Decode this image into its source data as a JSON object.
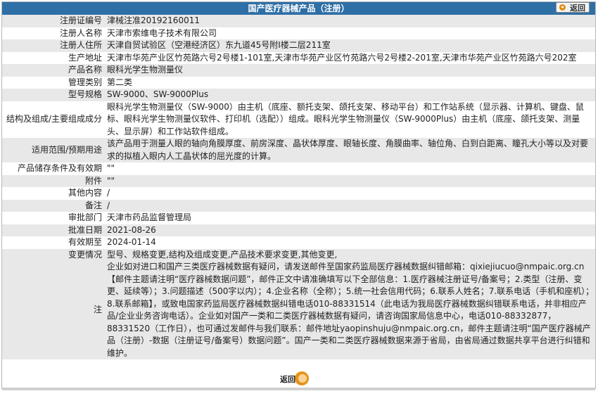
{
  "header": {
    "title": "国产医疗器械产品（注册）",
    "back_label": "返回"
  },
  "rows": [
    {
      "label": "注册证编号",
      "value": "津械注准20192160011"
    },
    {
      "label": "注册人名称",
      "value": "天津市索维电子技术有限公司"
    },
    {
      "label": "注册人住所",
      "value": "天津自贸试验区（空港经济区）东九道45号附Ⅰ楼二层211室"
    },
    {
      "label": "生产地址",
      "value": "天津市华苑产业区竹苑路六号2号楼1-101室,天津市华苑产业区竹苑路六号2号楼2-201室,天津市华苑产业区竹苑路六号202室"
    },
    {
      "label": "产品名称",
      "value": "眼科光学生物测量仪"
    },
    {
      "label": "管理类别",
      "value": "第二类"
    },
    {
      "label": "型号规格",
      "value": "SW-9000、SW-9000Plus"
    },
    {
      "label": "结构及组成/主要组成成分",
      "value": "眼科光学生物测量仪（SW-9000）由主机（底座、额托支架、颌托支架、移动平台）和工作站系统（显示器、计算机、键盘、鼠标、眼科光学生物测量仪软件、打印机（选配））组成。眼科光学生物测量仪（SW-9000Plus）由主机（底座、颌托支架、测量头、显示屏）和工作站软件组成。"
    },
    {
      "label": "适用范围/预期用途",
      "value": "该产品用于测量人眼的轴向角膜厚度、前房深度、晶状体厚度、眼轴长度、角膜曲率、轴位角、白到白距离、瞳孔大小等以及对要求的拟植入眼内人工晶状体的屈光度的计算。"
    },
    {
      "label": "产品储存条件及有效期",
      "value": "\"\""
    },
    {
      "label": "附件",
      "value": "\"\""
    },
    {
      "label": "其他内容",
      "value": "/"
    },
    {
      "label": "备注",
      "value": "/"
    },
    {
      "label": "审批部门",
      "value": "天津市药品监督管理局"
    },
    {
      "label": "批准日期",
      "value": "2021-08-26"
    },
    {
      "label": "有效期至",
      "value": "2024-01-14"
    },
    {
      "label": "变更情况",
      "value": "型号、规格变更,结构及组成变更,产品技术要求变更,其他变更,"
    },
    {
      "label": "注",
      "value": "企业如对进口和国产三类医疗器械数据有疑问，请发送邮件至国家药监局医疗器械数据纠错邮箱：qixiejiucuo@nmpaic.org.cn【邮件主题请注明“医疗器械数据问题”，邮件正文中请准确填写以下全部信息：1.医疗器械注册证号/备案号；2.类型（注册、变更、延续等）；3.问题描述（500字以内）；4.企业名称（全称）；5.统一社会信用代码；6.联系人姓名；7.联系电话（手机和座机）；8.联系邮箱】，或致电国家药监局医疗器械数据纠错电话010-88331514（此电话为我局医疗器械数据纠错联系电话，并非相应产品/企业业务咨询电话）。企业如对国产一类和二类医疗器械数据有疑问，请咨询国家局信息中心，电话010-88332877，88331520（工作日），也可通过发邮件与我们联系：邮件地址yaopinshuju@nmpaic.org.cn，邮件主题请注明“国产医疗器械产品（注册）-数据（注册证号/备案号）数据问题”。国产一类和二类医疗器械数据来源于省局，由省局通过数据共享平台进行纠错和维护。"
    }
  ],
  "footer": {
    "back_label": "返回"
  }
}
